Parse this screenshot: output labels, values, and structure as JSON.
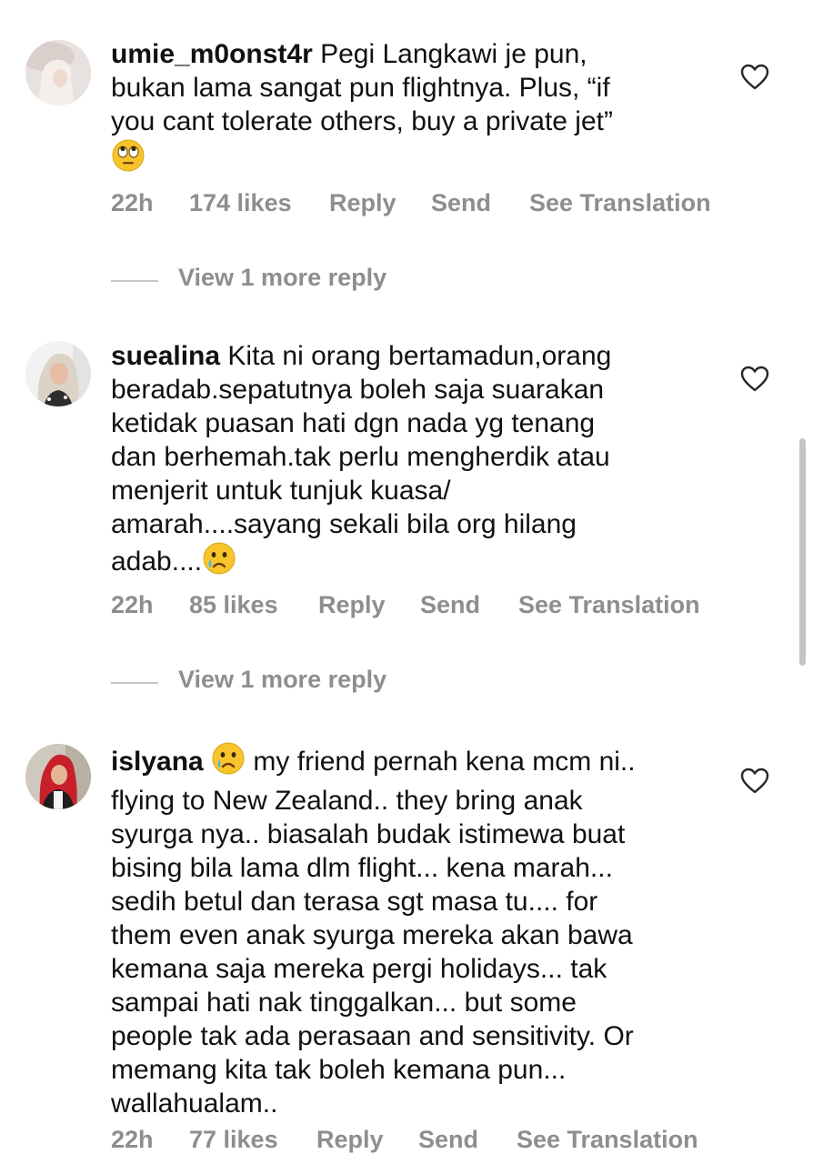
{
  "comments": [
    {
      "username": "umie_m0onst4r",
      "text": "Pegi Langkawi je pun,\nbukan lama sangat pun flightnya. Plus, “if\nyou cant tolerate others, buy a private jet”\n",
      "emoji_end": "face-with-rolling-eyes",
      "time": "22h",
      "likes": "174 likes",
      "reply": "Reply",
      "send": "Send",
      "translate": "See Translation",
      "view_more": "View 1 more reply"
    },
    {
      "username": "suealina",
      "text": "Kita ni orang bertamadun,orang\nberadab.sepatutnya boleh saja suarakan\nketidak puasan hati dgn nada yg tenang\ndan berhemah.tak perlu mengherdik atau\nmenjerit untuk tunjuk kuasa/\namarah....sayang sekali bila org hilang\nadab....",
      "emoji_end": "crying-face",
      "time": "22h",
      "likes": "85 likes",
      "reply": "Reply",
      "send": "Send",
      "translate": "See Translation",
      "view_more": "View 1 more reply"
    },
    {
      "username": "islyana",
      "emoji_start": "crying-face",
      "text": " my friend pernah kena mcm ni..\nflying to New Zealand.. they bring anak\nsyurga nya.. biasalah budak istimewa buat\nbising bila lama dlm flight... kena marah...\nsedih betul dan terasa sgt masa tu.... for\nthem even anak syurga mereka akan bawa\nkemana saja mereka pergi holidays... tak\nsampai hati nak tinggalkan... but some\npeople tak ada perasaan and sensitivity. Or\nmemang kita tak boleh kemana pun...\nwallahualam..",
      "time": "22h",
      "likes": "77 likes",
      "reply": "Reply",
      "send": "Send",
      "translate": "See Translation"
    }
  ],
  "icons": {
    "like": "heart-outline-icon"
  },
  "colors": {
    "meta_text": "#8e8e8e",
    "text": "#111111",
    "divider": "#c7c7c7"
  }
}
